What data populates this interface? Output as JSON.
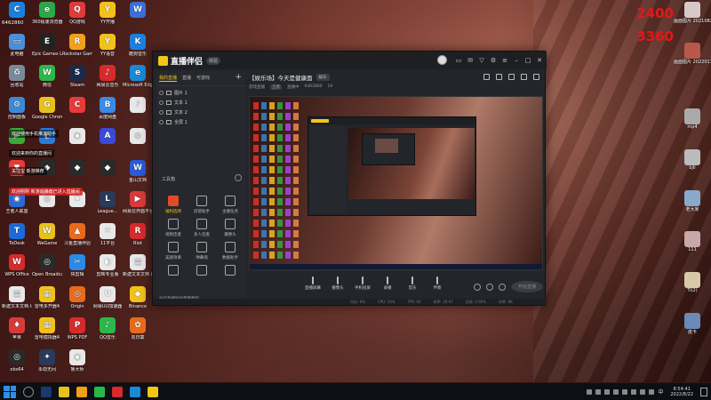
{
  "desktop_top_left": "6462860",
  "desktop_icons": [
    {
      "label": "",
      "color": "#1b7fe0",
      "glyph": "C"
    },
    {
      "label": "360极速浏览器",
      "color": "#2aa84a",
      "glyph": "e"
    },
    {
      "label": "QQ游戏",
      "color": "#e23a3a",
      "glyph": "Q"
    },
    {
      "label": "YY开播",
      "color": "#f2c21a",
      "glyph": "Y"
    },
    {
      "label": "",
      "color": "#3a6ed8",
      "glyph": "W"
    },
    {
      "label": "此电脑",
      "color": "#4a8fd8",
      "glyph": "▭"
    },
    {
      "label": "Epic Games Launcher",
      "color": "#222222",
      "glyph": "E"
    },
    {
      "label": "Rockstar Games...",
      "color": "#f2a01a",
      "glyph": "R"
    },
    {
      "label": "YY语音",
      "color": "#f2c21a",
      "glyph": "Y"
    },
    {
      "label": "酷狗音乐",
      "color": "#1b7fe0",
      "glyph": "K"
    },
    {
      "label": "回收站",
      "color": "#7a8a9a",
      "glyph": "♻"
    },
    {
      "label": "微信",
      "color": "#2ab84a",
      "glyph": "W"
    },
    {
      "label": "Steam",
      "color": "#1a2a4a",
      "glyph": "S"
    },
    {
      "label": "网易云音乐",
      "color": "#d82a2a",
      "glyph": "♪"
    },
    {
      "label": "Microsoft Edge",
      "color": "#1a8ad8",
      "glyph": "e"
    },
    {
      "label": "控制面板",
      "color": "#3a8ad8",
      "glyph": "⚙"
    },
    {
      "label": "Google Chrome",
      "color": "#e8c21a",
      "glyph": "G"
    },
    {
      "label": "",
      "color": "#e83a3a",
      "glyph": "C"
    },
    {
      "label": "百度网盘",
      "color": "#3a8ae8",
      "glyph": "B"
    },
    {
      "label": "",
      "color": "#e8e8e8",
      "glyph": "♪"
    },
    {
      "label": "",
      "color": "#3aa83a",
      "glyph": "▶"
    },
    {
      "label": "",
      "color": "#2a7ad8",
      "glyph": "◐"
    },
    {
      "label": "",
      "color": "#e8e8e8",
      "glyph": "◉"
    },
    {
      "label": "",
      "color": "#3a4ad8",
      "glyph": "A"
    },
    {
      "label": "",
      "color": "#e8e8e8",
      "glyph": "◎"
    },
    {
      "label": "",
      "color": "#e83a3a",
      "glyph": "▼"
    },
    {
      "label": "",
      "color": "#2a2a2a",
      "glyph": "◆"
    },
    {
      "label": "",
      "color": "#2a2a2a",
      "glyph": "◆"
    },
    {
      "label": "",
      "color": "#2a2a2a",
      "glyph": "◆"
    },
    {
      "label": "金山文档",
      "color": "#2a5ad8",
      "glyph": "W"
    },
    {
      "label": "王者人联盟",
      "color": "#2a6ad8",
      "glyph": "◉"
    },
    {
      "label": "",
      "color": "#e8e8e8",
      "glyph": "◎"
    },
    {
      "label": "",
      "color": "#e8e8e8",
      "glyph": "★"
    },
    {
      "label": "League...",
      "color": "#2a3a5a",
      "glyph": "L"
    },
    {
      "label": "网易云界面平台",
      "color": "#d83a3a",
      "glyph": "▶"
    },
    {
      "label": "ToDesk",
      "color": "#1a6ad8",
      "glyph": "T"
    },
    {
      "label": "WeGame",
      "color": "#e8c21a",
      "glyph": "W"
    },
    {
      "label": "斗鱼直播伴侣",
      "color": "#e86a1a",
      "glyph": "▲"
    },
    {
      "label": "11平台",
      "color": "#e8e8e8",
      "glyph": "✕"
    },
    {
      "label": "Riot",
      "color": "#d82a2a",
      "glyph": "R"
    },
    {
      "label": "WPS Office",
      "color": "#d82a2a",
      "glyph": "W"
    },
    {
      "label": "Open Broadcast...",
      "color": "#2a2a2a",
      "glyph": "◎"
    },
    {
      "label": "快剪辑",
      "color": "#2a8ae8",
      "glyph": "✂"
    },
    {
      "label": "剪映专业版",
      "color": "#e8e8e8",
      "glyph": "◐"
    },
    {
      "label": "新建文本文档 (2).txt",
      "color": "#e8e8e8",
      "glyph": "▤"
    },
    {
      "label": "新建文本文档.txt",
      "color": "#e8e8e8",
      "glyph": "▤"
    },
    {
      "label": "雷电多开器4",
      "color": "#f2c21a",
      "glyph": "▦"
    },
    {
      "label": "Origin",
      "color": "#e86a1a",
      "glyph": "◎"
    },
    {
      "label": "网易UU加速器",
      "color": "#e8e8e8",
      "glyph": "U"
    },
    {
      "label": "Binance",
      "color": "#f2c21a",
      "glyph": "◆"
    },
    {
      "label": "苹果",
      "color": "#d83a3a",
      "glyph": "♦"
    },
    {
      "label": "雷电模拟器4",
      "color": "#f2c21a",
      "glyph": "▦"
    },
    {
      "label": "WPS PDF",
      "color": "#d82a2a",
      "glyph": "P"
    },
    {
      "label": "QQ音乐",
      "color": "#2ab84a",
      "glyph": "♪"
    },
    {
      "label": "向日葵",
      "color": "#e86a1a",
      "glyph": "✿"
    },
    {
      "label": "obs64",
      "color": "#2a2a2a",
      "glyph": "◎"
    },
    {
      "label": "永劫无间",
      "color": "#2a3a5a",
      "glyph": "✦"
    },
    {
      "label": "鲁大师",
      "color": "#e8e8e8",
      "glyph": "◉"
    }
  ],
  "desktop_overlays": {
    "line1": "欢迎使用手机推流助手",
    "line2": "欢迎来到你的直播间",
    "line3": "关注宝  新游推荐",
    "red_line": "欢迎刚刚 新游戏推荐已进入直播间"
  },
  "right_numbers": {
    "top": "2400",
    "bottom": "3360"
  },
  "right_icons": [
    {
      "label": "画面图片 2021082...",
      "color": "#d8c8c8"
    },
    {
      "label": "画面图片 2022011...",
      "color": "#b8584a"
    },
    {
      "label": "mp4",
      "color": "#aaaaaa"
    },
    {
      "label": "bjli",
      "color": "#bbbbbb"
    },
    {
      "label": "老大家",
      "color": "#8aa8c8"
    },
    {
      "label": "111",
      "color": "#c8a8a8"
    },
    {
      "label": "Ti(2)",
      "color": "#d8c8a8"
    },
    {
      "label": "皮卡",
      "color": "#6a8ab8"
    }
  ],
  "app": {
    "name": "直播伴侣",
    "badge": "体验",
    "left_tabs": [
      "我的直播",
      "直播",
      "可游戏"
    ],
    "sources": [
      "图片 1",
      "文本 1",
      "文本 2",
      "全屏 1"
    ],
    "tools_heading": "工具箱",
    "tools": [
      {
        "label": "福利选项"
      },
      {
        "label": "房管助手"
      },
      {
        "label": "主播任务"
      },
      {
        "label": "视频连麦"
      },
      {
        "label": "多人连麦"
      },
      {
        "label": "摄像头"
      },
      {
        "label": "美颜效果"
      },
      {
        "label": "弹幕墙"
      },
      {
        "label": "数据助手"
      },
      {
        "label": ""
      },
      {
        "label": ""
      },
      {
        "label": ""
      }
    ],
    "footer": "今日直播时段使用教程",
    "room_title": "【娱乐场】今天是健康面",
    "room_tag": "娱乐",
    "stats": {
      "label1": "游戏直播",
      "label2": "王者",
      "live": "直播中",
      "count": "6462860",
      "fans": "19"
    },
    "controls": [
      "直播屏幕",
      "摄像头",
      "手机投屏",
      "录播",
      "音乐",
      "伴奏",
      "截图",
      "特效"
    ],
    "start_button": "开始直播",
    "status": [
      "内存: 6%",
      "CPU: 10%",
      "FPS: 60",
      "帧率: 29.97",
      "丢帧: 0.00%",
      "码率: 6K"
    ]
  },
  "taskbar": {
    "time": "8:54:41",
    "date": "2022/8/22",
    "lang": "中"
  }
}
